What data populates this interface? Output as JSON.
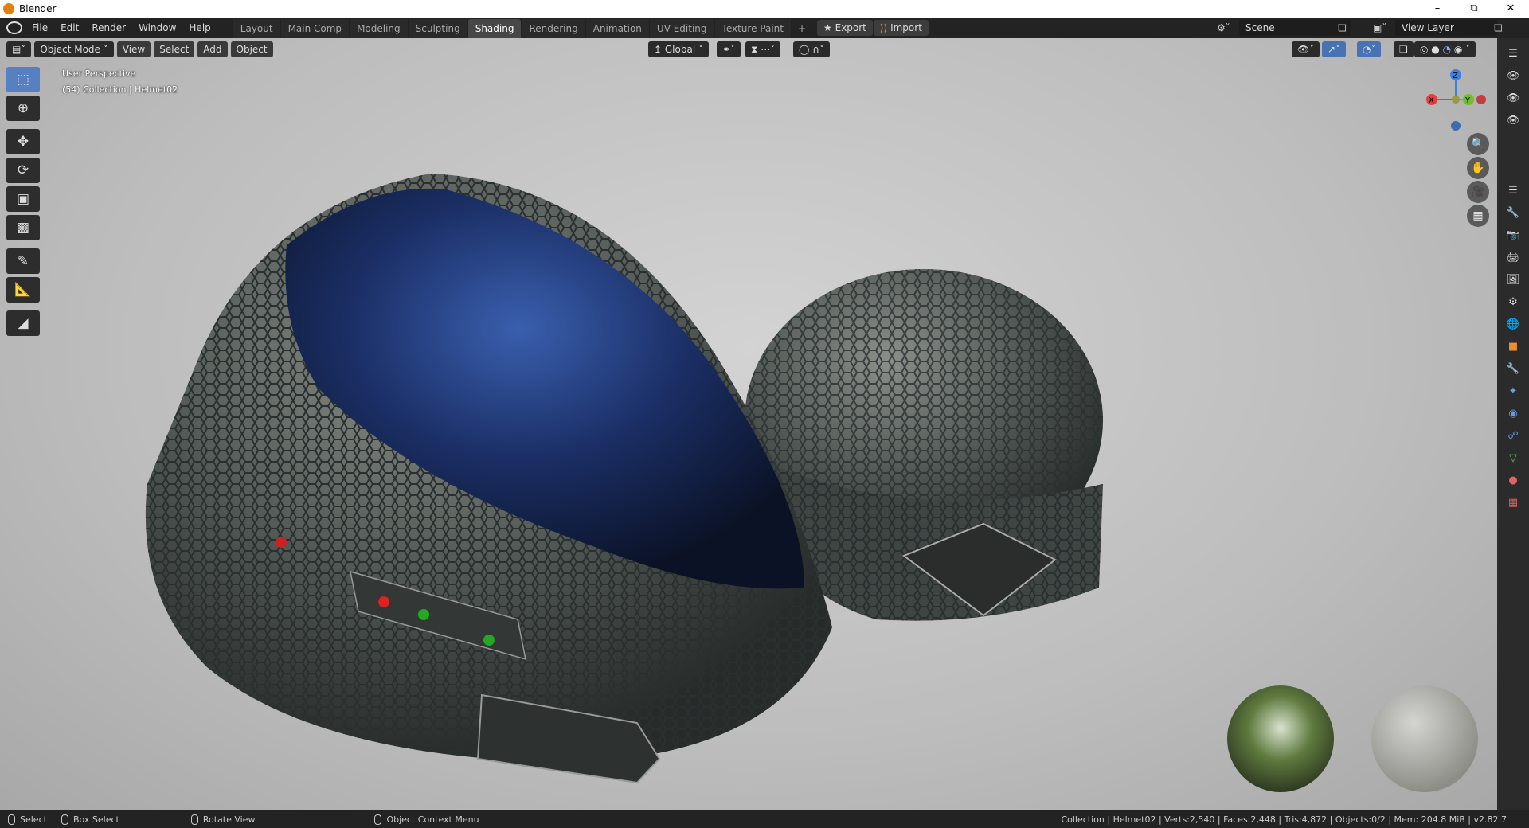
{
  "window": {
    "title": "Blender"
  },
  "menu": [
    "File",
    "Edit",
    "Render",
    "Window",
    "Help"
  ],
  "tabs": [
    {
      "label": "Layout"
    },
    {
      "label": "Main Comp"
    },
    {
      "label": "Modeling"
    },
    {
      "label": "Sculpting"
    },
    {
      "label": "Shading",
      "active": true
    },
    {
      "label": "Rendering"
    },
    {
      "label": "Animation"
    },
    {
      "label": "UV Editing"
    },
    {
      "label": "Texture Paint"
    }
  ],
  "addons": {
    "export": "Export",
    "import": "Import"
  },
  "scene": {
    "name": "Scene",
    "view_layer": "View Layer"
  },
  "header": {
    "mode": "Object Mode",
    "view": "View",
    "select": "Select",
    "add": "Add",
    "object": "Object",
    "orientation": "Global"
  },
  "viewport": {
    "perspective": "User Perspective",
    "collection": "(54) Collection | Helmet02"
  },
  "gizmo": {
    "x": "X",
    "y": "Y",
    "z": "Z"
  },
  "status": {
    "select": "Select",
    "box_select": "Box Select",
    "rotate": "Rotate View",
    "context": "Object Context Menu",
    "stats": "Collection | Helmet02 | Verts:2,540 | Faces:2,448 | Tris:4,872 | Objects:0/2 | Mem: 204.8 MiB | v2.82.7"
  }
}
